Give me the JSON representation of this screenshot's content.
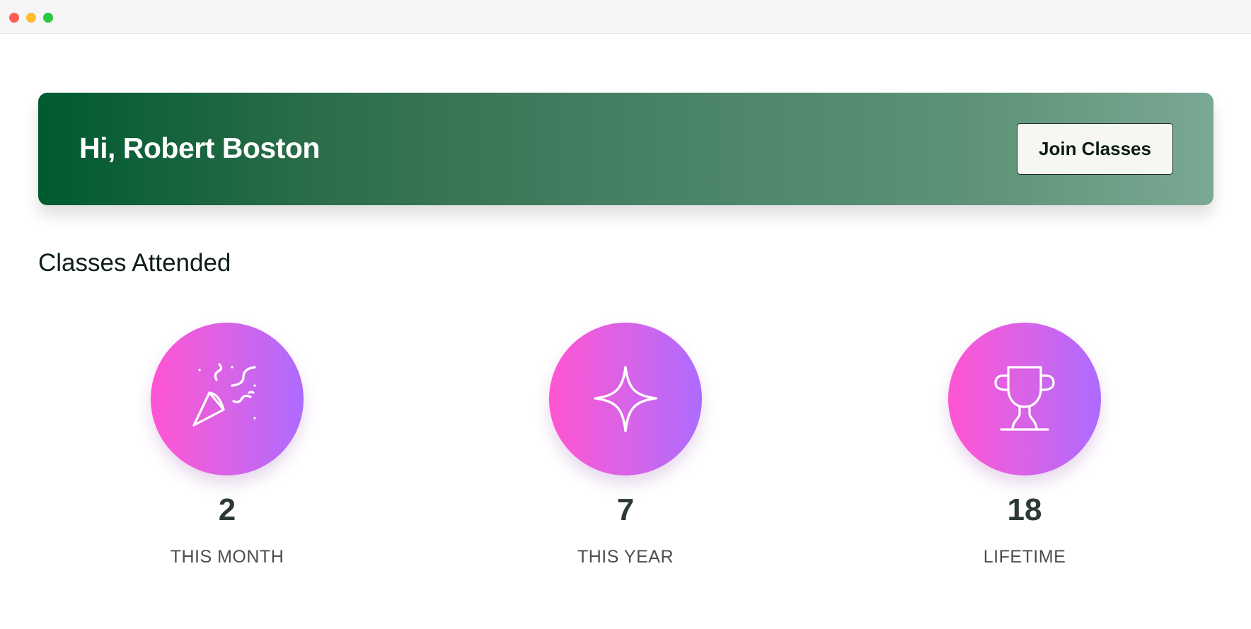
{
  "header": {
    "greeting": "Hi, Robert Boston",
    "join_label": "Join Classes"
  },
  "section": {
    "title": "Classes Attended"
  },
  "stats": [
    {
      "value": "2",
      "label": "THIS MONTH",
      "icon": "party-popper-icon"
    },
    {
      "value": "7",
      "label": "THIS YEAR",
      "icon": "sparkle-icon"
    },
    {
      "value": "18",
      "label": "LIFETIME",
      "icon": "trophy-icon"
    }
  ],
  "colors": {
    "banner_start": "#005a30",
    "banner_end": "#7aa894",
    "circle_start": "#ff55d2",
    "circle_end": "#ad6bff"
  }
}
